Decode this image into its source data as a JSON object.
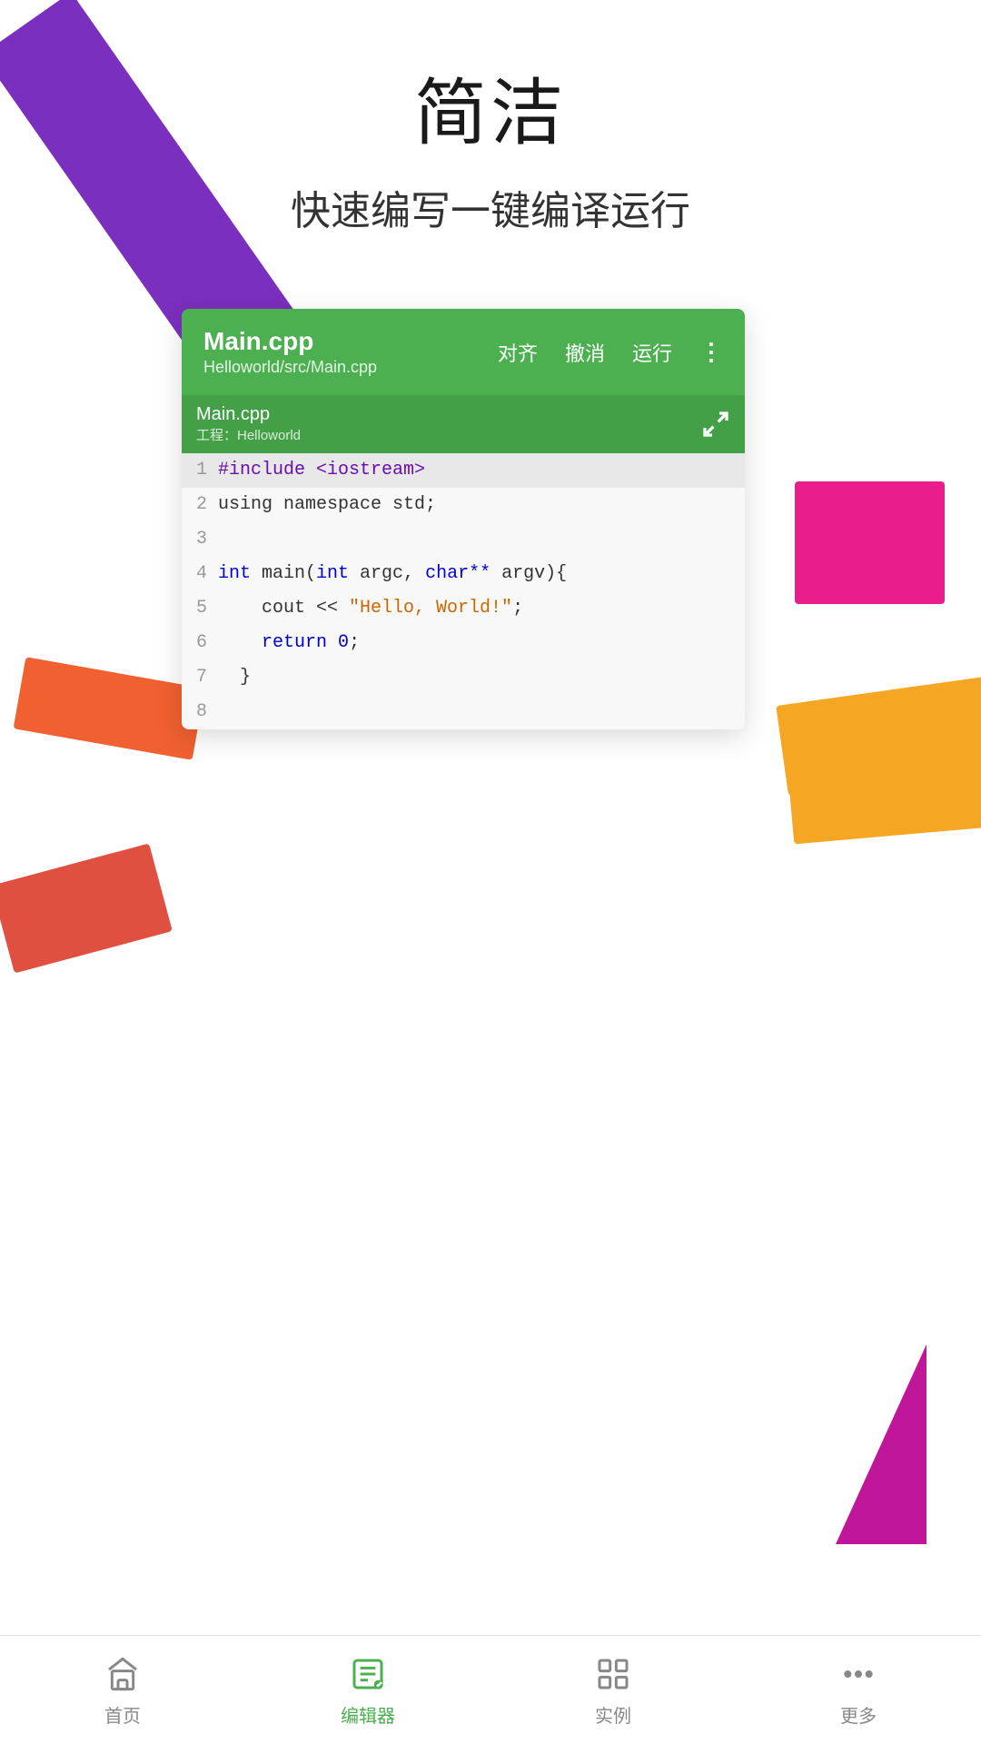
{
  "page": {
    "headline": "简洁",
    "subheadline": "快速编写一键编译运行"
  },
  "editor": {
    "filename": "Main.cpp",
    "path": "Helloworld/src/Main.cpp",
    "tab_filename": "Main.cpp",
    "tab_project": "工程：Helloworld",
    "actions": {
      "align": "对齐",
      "undo": "撤消",
      "run": "运行"
    },
    "code_lines": [
      {
        "number": "1",
        "content": "#include <iostream>"
      },
      {
        "number": "2",
        "content": "using namespace std;"
      },
      {
        "number": "3",
        "content": ""
      },
      {
        "number": "4",
        "content": "int main(int argc, char** argv){"
      },
      {
        "number": "5",
        "content": "    cout << \"Hello, World!\";"
      },
      {
        "number": "6",
        "content": "    return 0;"
      },
      {
        "number": "7",
        "content": "  }"
      },
      {
        "number": "8",
        "content": ""
      }
    ]
  },
  "bottom_nav": {
    "items": [
      {
        "id": "home",
        "label": "首页",
        "active": false
      },
      {
        "id": "editor",
        "label": "编辑器",
        "active": true
      },
      {
        "id": "examples",
        "label": "实例",
        "active": false
      },
      {
        "id": "more",
        "label": "更多",
        "active": false
      }
    ]
  }
}
